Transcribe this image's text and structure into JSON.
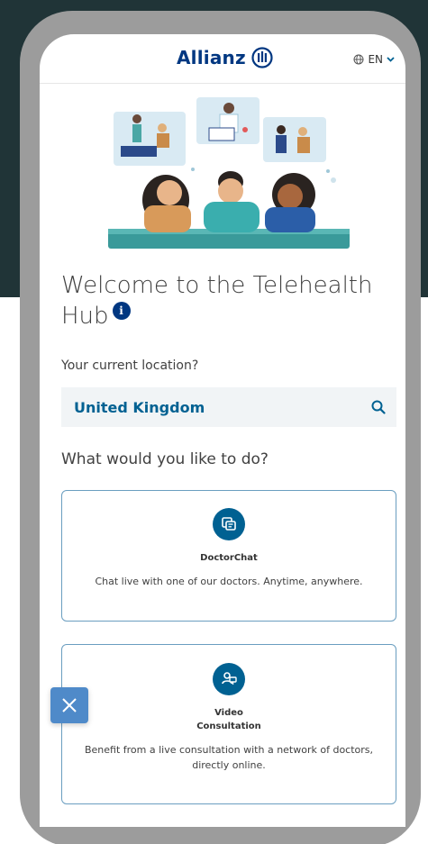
{
  "brand": {
    "name": "Allianz",
    "color": "#003781"
  },
  "header": {
    "language": "EN"
  },
  "page": {
    "title_line1": "Welcome to the Telehealth",
    "title_line2": "Hub",
    "info_icon_label": "i"
  },
  "location": {
    "label": "Your current location?",
    "value": "United Kingdom"
  },
  "question": "What would you like to do?",
  "cards": [
    {
      "icon": "chat-icon",
      "title": "DoctorChat",
      "description": "Chat live with one of our doctors. Anytime, anywhere."
    },
    {
      "icon": "video-consultation-icon",
      "title_line1": "Video",
      "title_line2": "Consultation",
      "description": "Benefit from a live consultation with a network of doctors, directly online."
    }
  ],
  "colors": {
    "accent": "#006192",
    "close_button": "#4f8ac9",
    "card_border": "#6a9ec0"
  }
}
